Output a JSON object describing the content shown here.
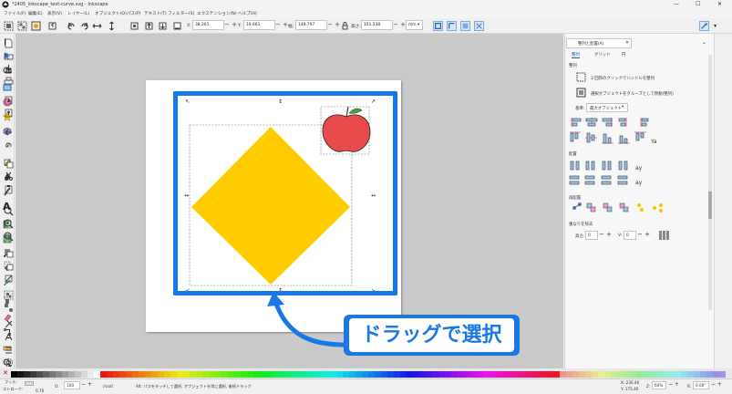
{
  "window": {
    "title": "*2405_inkscape_text-curve.svg - Inkscape",
    "controls": [
      "—",
      "☐",
      "✕"
    ]
  },
  "menubar": {
    "items": [
      "ファイル(F)",
      "編集(E)",
      "表示(V)",
      "レイヤー(L)",
      "オブジェクト(O)",
      "パス(P)",
      "テキスト(T)",
      "フィルター(S)",
      "エクステンション(N)",
      "ヘルプ(H)"
    ]
  },
  "toolbar": {
    "x_label": "X:",
    "x_value": "38.201",
    "y_label": "Y:",
    "y_value": "19.661",
    "w_label": "幅:",
    "w_value": "149.797",
    "h_label": "高さ:",
    "h_value": "151.538",
    "unit": "mm"
  },
  "canvas": {
    "callout_text": "ドラッグで選択",
    "diamond_color": "#ffcc00",
    "apple_color": "#e84a4a",
    "highlight_color": "#1677e8"
  },
  "dock": {
    "tab_title": "整列と配置(A)",
    "tabs": [
      "整列",
      "グリッド",
      "円"
    ],
    "section_align": "整列",
    "opt_move_handles": "3 回目のクリックでハンドルを整列",
    "opt_move_group": "選択オブジェクトをグループとして移動(整列)",
    "relative_label": "基準:",
    "relative_value": "最大オブジェクト",
    "section_distribute": "配置",
    "section_rearrange": "再配置",
    "section_overlap": "重なりを除去",
    "h_label": "高さ:",
    "h_value": "0",
    "v_label": "V:",
    "v_value": "0"
  },
  "statusbar": {
    "fill_label": "フィル:",
    "stroke_label": "ストローク:",
    "opacity_label": "O:",
    "opacity_value": "100",
    "stroke_width": "0.70",
    "layer": "/root/",
    "message": "Alt: パスをタッチして選択, オブジェクトを常に選択, 後続ドラッグ",
    "x_coord": "X:  236.46",
    "y_coord": "Y:  175.40",
    "zoom_label": "Z:",
    "zoom_value": "60%",
    "rotate_label": "R:",
    "rotate_value": "0.00°"
  }
}
